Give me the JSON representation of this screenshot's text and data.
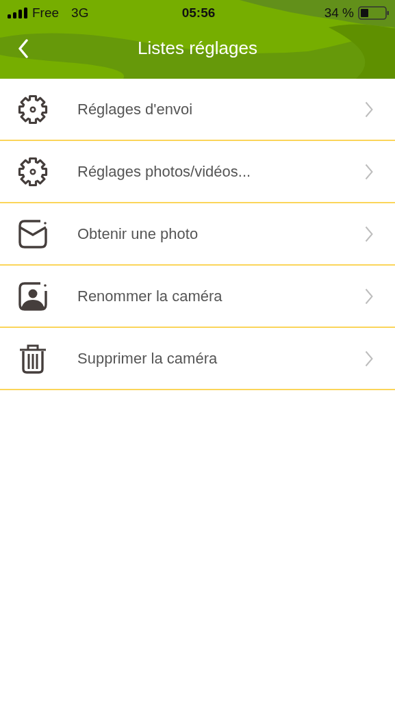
{
  "status_bar": {
    "carrier": "Free",
    "network": "3G",
    "time": "05:56",
    "battery": "34 %"
  },
  "nav": {
    "title": "Listes réglages"
  },
  "items": [
    {
      "kind": "gear",
      "label": "Réglages d'envoi"
    },
    {
      "kind": "gear",
      "label": "Réglages photos/vidéos..."
    },
    {
      "kind": "envelope",
      "label": "Obtenir une photo"
    },
    {
      "kind": "portrait",
      "label": "Renommer la caméra"
    },
    {
      "kind": "trash",
      "label": "Supprimer la caméra"
    }
  ]
}
